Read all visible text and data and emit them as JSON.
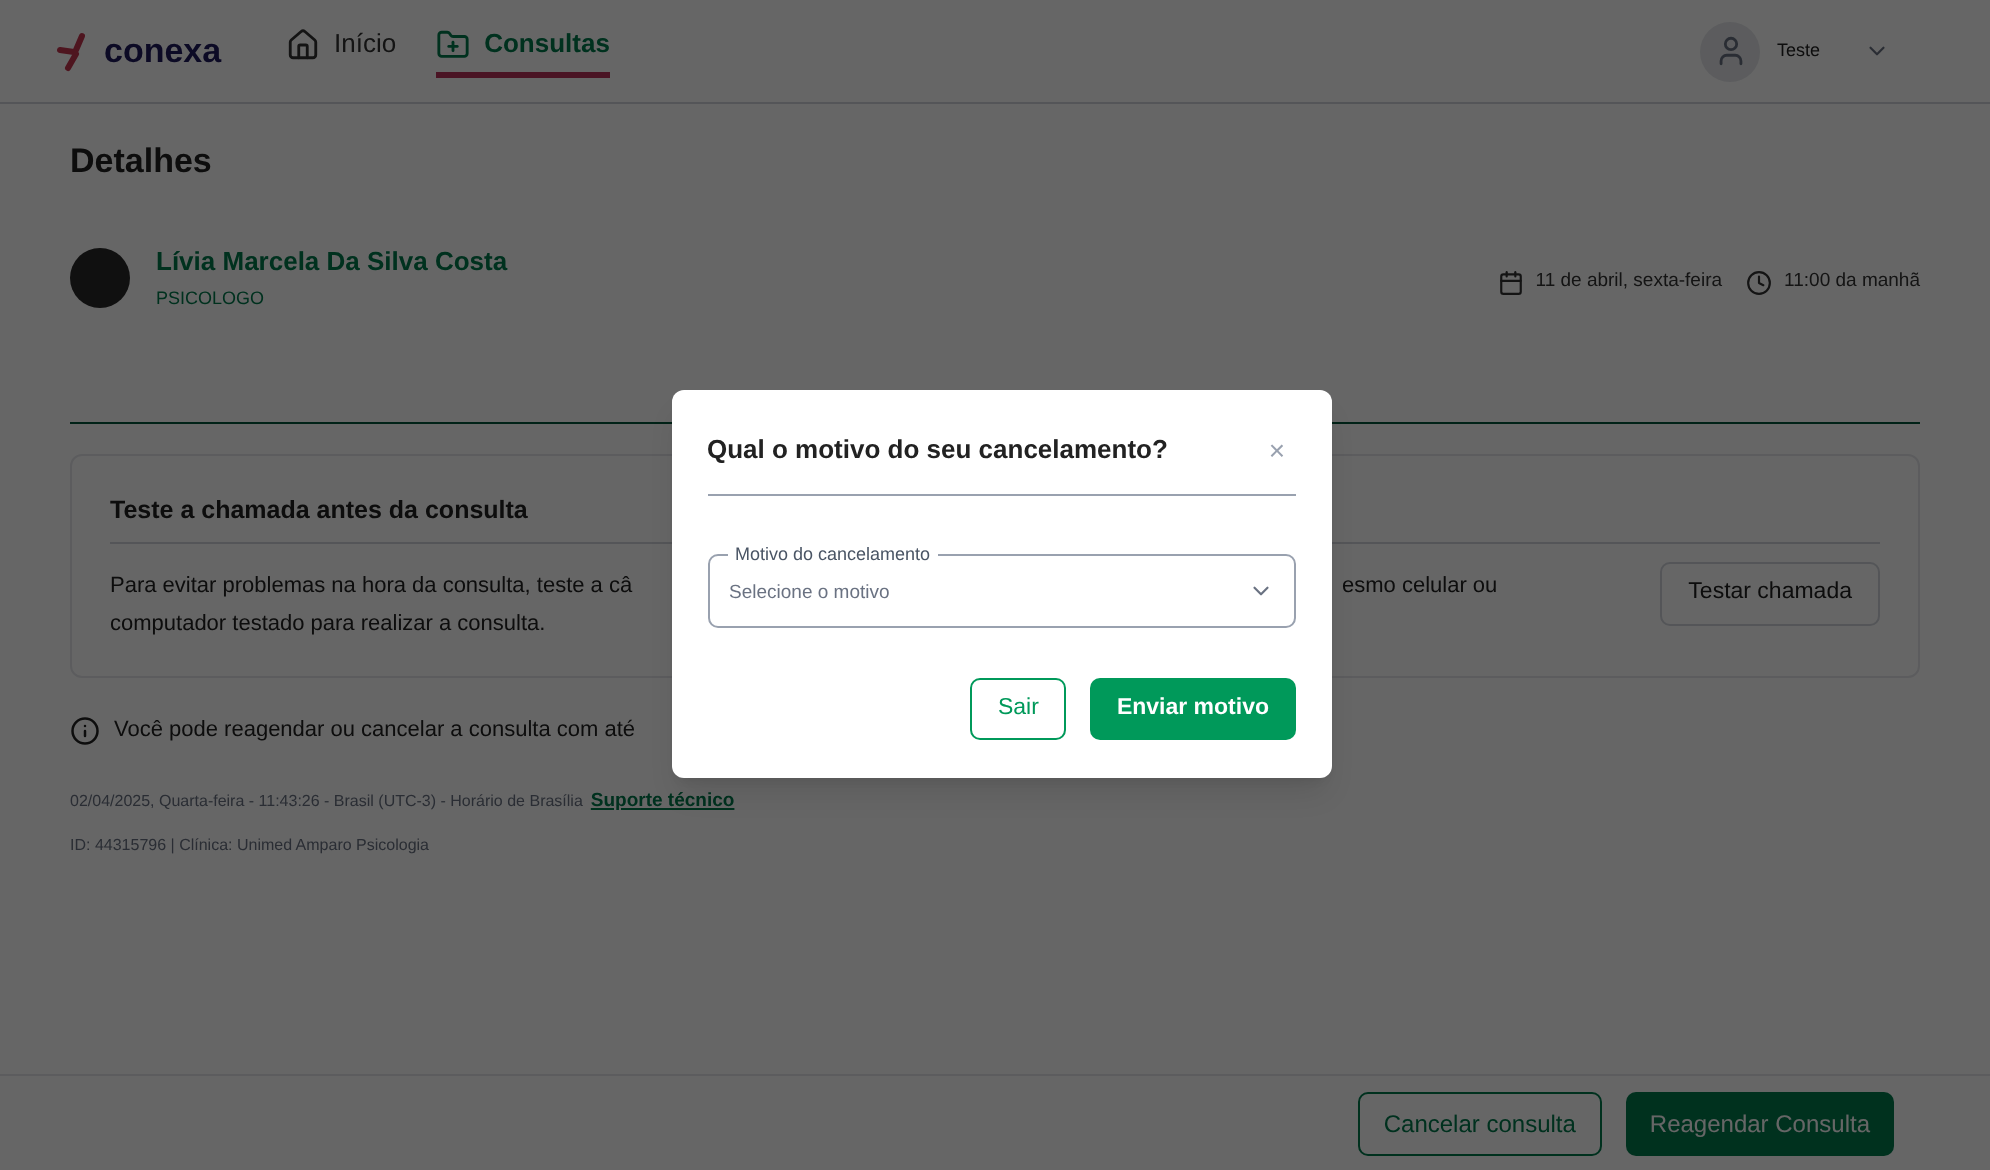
{
  "header": {
    "logo": "conexa",
    "nav": [
      {
        "label": "Início",
        "selected": false,
        "kind": "home"
      },
      {
        "label": "Consultas",
        "selected": true,
        "kind": "folder"
      }
    ],
    "user": {
      "name": "Teste"
    }
  },
  "page": {
    "title": "Detalhes",
    "professional": {
      "name": "Lívia Marcela Da Silva Costa",
      "role": "PSICOLOGO"
    },
    "date": "11 de abril, sexta-feira",
    "time": "11:00 da manhã",
    "test_card": {
      "title": "Teste a chamada antes da consulta",
      "text_left": [
        "Para evitar problemas na hora da consulta, teste a câ",
        "computador testado para realizar a consulta."
      ],
      "text_right": "esmo celular ou",
      "button": "Testar chamada"
    },
    "info": "Você pode reagendar ou cancelar a consulta com até",
    "footer_line": "02/04/2025, Quarta-feira - 11:43:26 - Brasil (UTC-3) - Horário de Brasília",
    "support_link": "Suporte técnico",
    "id_line": "ID: 44315796 | Clínica: Unimed Amparo Psicologia"
  },
  "actions": {
    "cancel": "Cancelar consulta",
    "reschedule": "Reagendar Consulta"
  },
  "modal": {
    "title": "Qual o motivo do seu cancelamento?",
    "close": "×",
    "select": {
      "label": "Motivo do cancelamento",
      "placeholder": "Selecione o motivo"
    },
    "buttons": {
      "secondary": "Sair",
      "primary": "Enviar motivo"
    }
  }
}
